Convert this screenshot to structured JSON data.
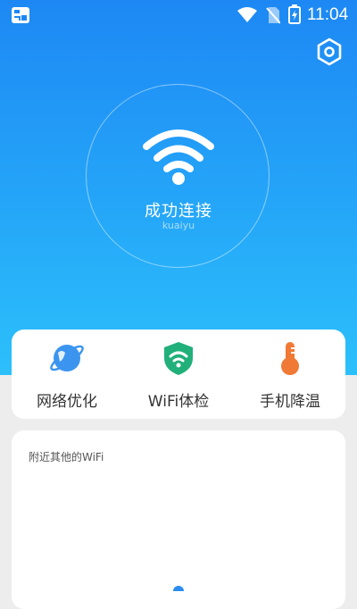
{
  "statusbar": {
    "time": "11:04",
    "icons": [
      "app-icon",
      "wifi-icon",
      "no-sim-icon",
      "battery-charging-icon"
    ]
  },
  "header": {
    "settings_icon": "settings-hex-icon"
  },
  "connection": {
    "icon": "wifi-icon",
    "status": "成功连接",
    "ssid": "kuaiyu"
  },
  "tools": [
    {
      "label": "网络优化",
      "icon": "planet-icon",
      "color": "#3b95ef"
    },
    {
      "label": "WiFi体检",
      "icon": "shield-wifi-icon",
      "color": "#21b07a"
    },
    {
      "label": "手机降温",
      "icon": "thermometer-icon",
      "color": "#f07a35"
    }
  ],
  "nearby": {
    "title": "附近其他的WiFi"
  },
  "colors": {
    "hero_top": "#1d88f4",
    "hero_bottom": "#2cc0fb",
    "background": "#ededed"
  }
}
